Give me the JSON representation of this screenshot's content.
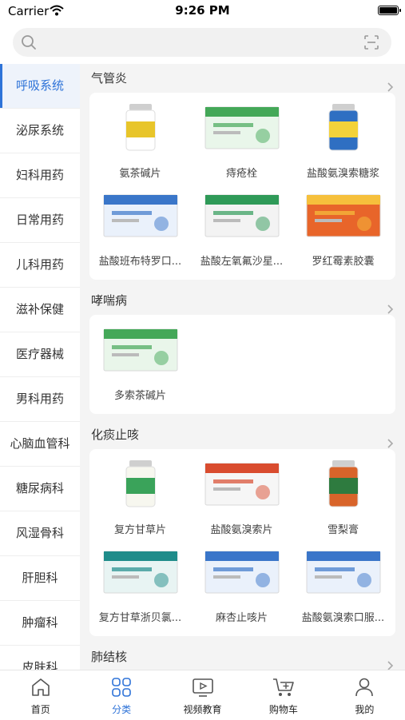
{
  "status_bar": {
    "carrier": "Carrier",
    "time": "9:26 PM"
  },
  "search": {
    "placeholder": ""
  },
  "sidebar": {
    "items": [
      {
        "label": "呼吸系统",
        "active": true
      },
      {
        "label": "泌尿系统"
      },
      {
        "label": "妇科用药"
      },
      {
        "label": "日常用药"
      },
      {
        "label": "儿科用药"
      },
      {
        "label": "滋补保健"
      },
      {
        "label": "医疗器械"
      },
      {
        "label": "男科用药"
      },
      {
        "label": "心脑血管科"
      },
      {
        "label": "糖尿病科"
      },
      {
        "label": "风湿骨科"
      },
      {
        "label": "肝胆科"
      },
      {
        "label": "肿瘤科"
      },
      {
        "label": "皮肤科"
      }
    ]
  },
  "sections": [
    {
      "title": "气管炎",
      "products": [
        {
          "name": "氨茶碱片",
          "icon": "white-bottle-icon"
        },
        {
          "name": "痔疮栓",
          "icon": "green-box-icon"
        },
        {
          "name": "盐酸氨溴索糖浆",
          "icon": "blue-bottle-icon"
        },
        {
          "name": "盐酸班布特罗口...",
          "icon": "blue-box-icon"
        },
        {
          "name": "盐酸左氧氟沙星...",
          "icon": "green-stripe-box-icon"
        },
        {
          "name": "罗红霉素胶囊",
          "icon": "orange-box-icon"
        }
      ]
    },
    {
      "title": "哮喘病",
      "products": [
        {
          "name": "多索茶碱片",
          "icon": "green-box-icon"
        }
      ]
    },
    {
      "title": "化痰止咳",
      "products": [
        {
          "name": "复方甘草片",
          "icon": "green-bottle-icon"
        },
        {
          "name": "盐酸氨溴索片",
          "icon": "white-box-icon"
        },
        {
          "name": "雪梨膏",
          "icon": "orange-jar-icon"
        },
        {
          "name": "复方甘草浙贝氯...",
          "icon": "teal-box-icon"
        },
        {
          "name": "麻杏止咳片",
          "icon": "blue-box-icon"
        },
        {
          "name": "盐酸氨溴索口服...",
          "icon": "blue-box-icon"
        }
      ]
    },
    {
      "title": "肺结核",
      "products": []
    }
  ],
  "tabbar": {
    "items": [
      {
        "label": "首页",
        "icon": "home-icon"
      },
      {
        "label": "分类",
        "icon": "category-grid-icon",
        "active": true
      },
      {
        "label": "视频教育",
        "icon": "video-play-icon"
      },
      {
        "label": "购物车",
        "icon": "cart-icon"
      },
      {
        "label": "我的",
        "icon": "profile-icon"
      }
    ]
  },
  "colors": {
    "accent": "#2e73d8",
    "sidebar_active_bg": "#eef3fb"
  }
}
